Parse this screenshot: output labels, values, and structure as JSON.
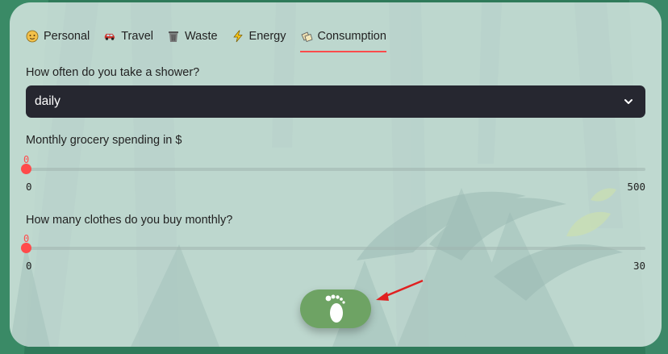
{
  "tabs": [
    {
      "label": "Personal",
      "icon": "person-emoji-icon"
    },
    {
      "label": "Travel",
      "icon": "car-icon"
    },
    {
      "label": "Waste",
      "icon": "trash-can-icon"
    },
    {
      "label": "Energy",
      "icon": "lightning-icon"
    },
    {
      "label": "Consumption",
      "icon": "shopping-bags-icon",
      "active": true
    }
  ],
  "shower": {
    "label": "How often do you take a shower?",
    "value": "daily"
  },
  "grocery": {
    "label": "Monthly grocery spending in $",
    "value": "0",
    "min": "0",
    "max": "500"
  },
  "clothes": {
    "label": "How many clothes do you buy monthly?",
    "value": "0",
    "min": "0",
    "max": "30"
  },
  "colors": {
    "accent": "#ff4b4b",
    "button": "#6ea364",
    "select_bg": "#262730",
    "background": "#2f7a5a"
  }
}
